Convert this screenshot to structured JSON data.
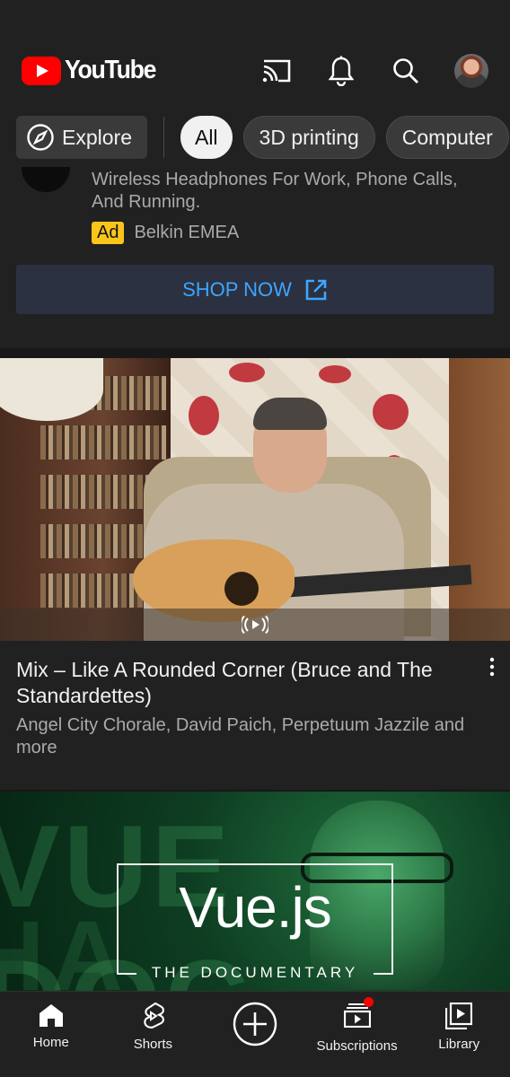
{
  "header": {
    "logo_text": "YouTube",
    "icons": [
      "cast-icon",
      "notifications-bell-icon",
      "search-icon",
      "account-avatar"
    ]
  },
  "chips": {
    "explore_label": "Explore",
    "items": [
      {
        "label": "All",
        "selected": true
      },
      {
        "label": "3D printing",
        "selected": false
      },
      {
        "label": "Computer",
        "selected": false
      }
    ]
  },
  "ad": {
    "description": "Wireless Headphones For Work, Phone Calls, And Running.",
    "badge": "Ad",
    "sponsor": "Belkin EMEA",
    "cta_label": "SHOP NOW"
  },
  "video1": {
    "title": "Mix – Like A Rounded Corner (Bruce and The Standardettes)",
    "subtitle": "Angel City Chorale, David Paich, Perpetuum Jazzile and more"
  },
  "video2": {
    "thumb_title": "Vue.js",
    "thumb_subtitle": "THE DOCUMENTARY"
  },
  "bottom_nav": {
    "home": "Home",
    "shorts": "Shorts",
    "subscriptions": "Subscriptions",
    "library": "Library"
  },
  "colors": {
    "brand_red": "#ff0000",
    "background": "#212121",
    "link_blue": "#3ea6ff",
    "ad_badge": "#f9c51b"
  }
}
